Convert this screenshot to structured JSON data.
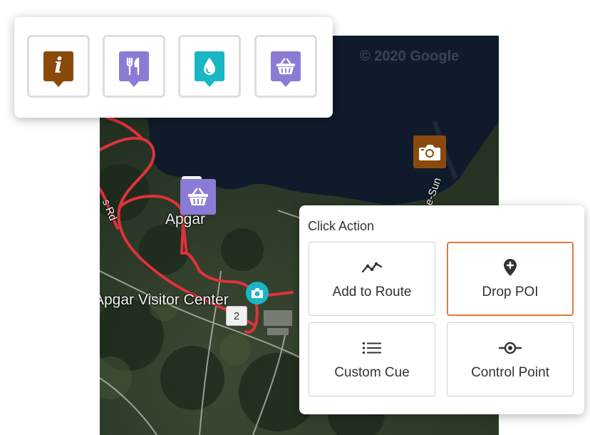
{
  "map": {
    "copyright": "© 2020 Google",
    "labels": {
      "apgar": "Apgar",
      "visitor_center": "Apgar Visitor Center",
      "road_left": "s Rd",
      "road_right": "e-Sun"
    },
    "cue_number": "2",
    "route_color": "#e0323c",
    "water_color": "#0f1b2b"
  },
  "poi_categories": [
    {
      "name": "info",
      "color": "#8a4a0c"
    },
    {
      "name": "food",
      "color": "#8c7bd6"
    },
    {
      "name": "water",
      "color": "#19b6c4"
    },
    {
      "name": "shopping",
      "color": "#8c7bd6"
    }
  ],
  "click_action": {
    "title": "Click Action",
    "buttons": [
      {
        "label": "Add to Route",
        "icon": "route-icon",
        "selected": false
      },
      {
        "label": "Drop POI",
        "icon": "map-pin-plus-icon",
        "selected": true
      },
      {
        "label": "Custom Cue",
        "icon": "list-icon",
        "selected": false
      },
      {
        "label": "Control Point",
        "icon": "control-point-icon",
        "selected": false
      }
    ],
    "accent_color": "#e07a3e"
  }
}
